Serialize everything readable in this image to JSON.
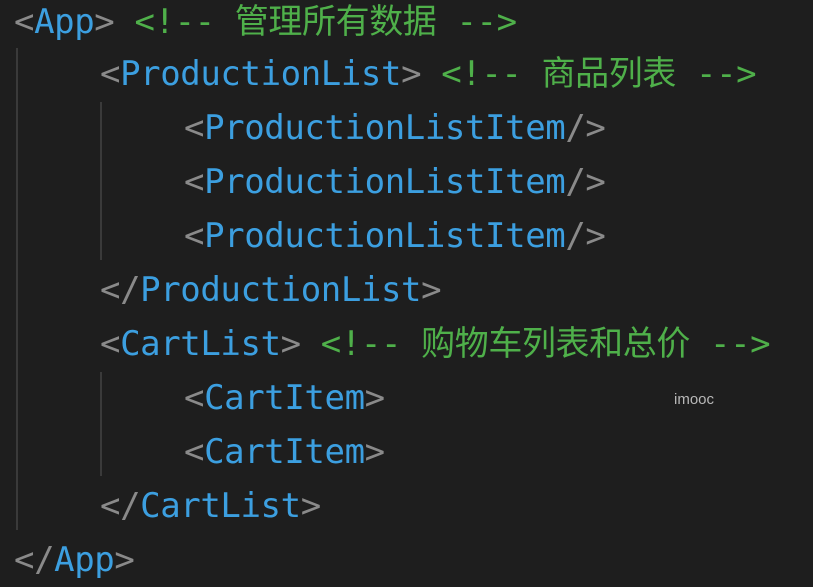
{
  "lines": [
    {
      "open": "<",
      "tag": "App",
      "close": ">",
      "comment": "<!-- 管理所有数据 -->"
    },
    {
      "open": "<",
      "tag": "ProductionList",
      "close": ">",
      "comment": "<!-- 商品列表 -->"
    },
    {
      "open": "<",
      "tag": "ProductionListItem",
      "close": "/>",
      "comment": ""
    },
    {
      "open": "<",
      "tag": "ProductionListItem",
      "close": "/>",
      "comment": ""
    },
    {
      "open": "<",
      "tag": "ProductionListItem",
      "close": "/>",
      "comment": ""
    },
    {
      "open": "</",
      "tag": "ProductionList",
      "close": ">",
      "comment": ""
    },
    {
      "open": "<",
      "tag": "CartList",
      "close": ">",
      "comment": "<!-- 购物车列表和总价 -->"
    },
    {
      "open": "<",
      "tag": "CartItem",
      "close": ">",
      "comment": ""
    },
    {
      "open": "<",
      "tag": "CartItem",
      "close": ">",
      "comment": ""
    },
    {
      "open": "</",
      "tag": "CartList",
      "close": ">",
      "comment": ""
    },
    {
      "open": "</",
      "tag": "App",
      "close": ">",
      "comment": ""
    }
  ],
  "watermark": "imooc",
  "colors": {
    "background": "#1e1e1e",
    "punctuation": "#8a8a8a",
    "tag": "#3c9fe0",
    "comment": "#4fb04a"
  }
}
